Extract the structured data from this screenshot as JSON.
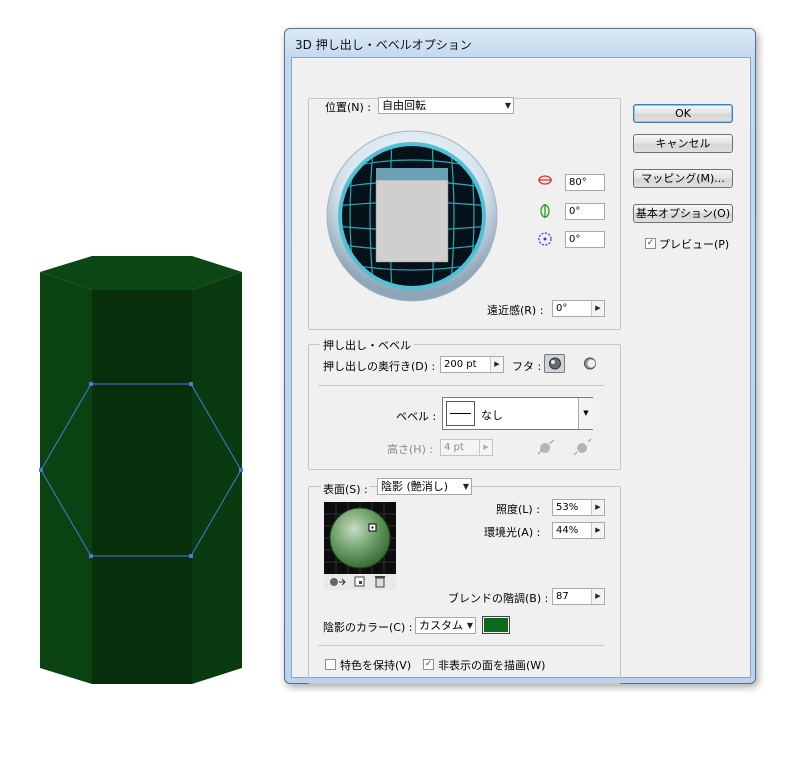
{
  "dialog": {
    "title": "3D 押し出し・ベベルオプション",
    "position": {
      "label": "位置(N) :",
      "preset": "自由回転",
      "rot_x": "80°",
      "rot_y": "0°",
      "rot_z": "0°",
      "perspective_label": "遠近感(R) :",
      "perspective": "0°"
    },
    "extrude": {
      "group_label": "押し出し・ベベル",
      "depth_label": "押し出しの奥行き(D) :",
      "depth": "200 pt",
      "cap_label": "フタ :",
      "bevel_label": "ベベル :",
      "bevel": "なし",
      "height_label": "高さ(H) :",
      "height": "4 pt"
    },
    "surface": {
      "label": "表面(S) :",
      "value": "陰影 (艶消し)",
      "light_intensity_label": "照度(L) :",
      "light_intensity": "53%",
      "ambient_label": "環境光(A) :",
      "ambient": "44%",
      "blend_steps_label": "ブレンドの階調(B) :",
      "blend_steps": "87",
      "shade_color_label": "陰影のカラー(C) :",
      "shade_color": "カスタム",
      "shade_swatch": "#0b6b1c",
      "preserve_spot_label": "特色を保持(V)",
      "preserve_spot": false,
      "draw_hidden_label": "非表示の面を描画(W)",
      "draw_hidden": true
    },
    "buttons": {
      "ok": "OK",
      "cancel": "キャンセル",
      "mapping": "マッピング(M)...",
      "basic": "基本オプション(O)"
    },
    "preview_label": "プレビュー(P)",
    "preview": true
  },
  "artwork": {
    "prism_color": "#0a3d10",
    "selection_color": "#4a78d8"
  }
}
